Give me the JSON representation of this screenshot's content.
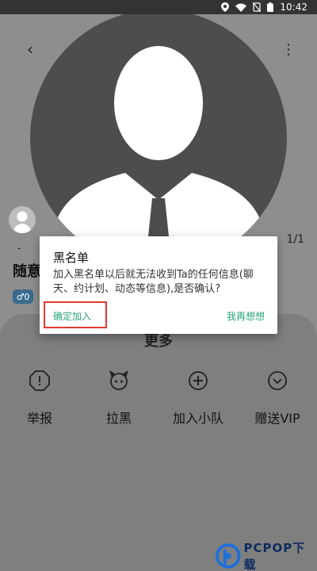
{
  "status_bar": {
    "time": "10:42",
    "icons": [
      "location-icon",
      "wifi-icon",
      "no-sim-icon",
      "battery-icon"
    ]
  },
  "header": {
    "back_icon": "‹",
    "more_icon": "⋮"
  },
  "profile": {
    "placeholder_dash": "-",
    "name": "随意",
    "gender_badge": "♂0",
    "page_count": "1/1"
  },
  "more_sheet": {
    "title": "更多",
    "actions": [
      {
        "label": "举报",
        "icon": "report-icon"
      },
      {
        "label": "拉黑",
        "icon": "devil-icon"
      },
      {
        "label": "加入小队",
        "icon": "add-circle-icon"
      },
      {
        "label": "赠送VIP",
        "icon": "chevron-circle-icon"
      }
    ]
  },
  "dialog": {
    "title": "黑名单",
    "message": "加入黑名单以后就无法收到Ta的任何信息(聊天、约计划、动态等信息),是否确认?",
    "confirm_label": "确定加入",
    "cancel_label": "我再想想"
  },
  "watermark": {
    "text": "PCPOP下载"
  },
  "colors": {
    "accent": "#2aa57a",
    "highlight": "#e53935",
    "watermark": "#0d2b5e"
  }
}
